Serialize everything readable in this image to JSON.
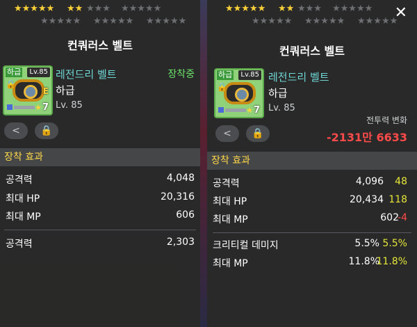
{
  "left": {
    "stars": {
      "row1a": "★★★★★",
      "row1b": "★★",
      "row1b_off": "★★★",
      "row1c": "★★★★★",
      "row2a": "★★★★★",
      "row2b": "★★★★★",
      "row2c": "★★★★★"
    },
    "title": "컨쿼러스 벨트",
    "item": {
      "grade_tag": "하급",
      "lv_tag": "Lv.85",
      "stack": "7",
      "e_badge": "E",
      "name": "레전드리 벨트",
      "grade": "하급",
      "level": "Lv. 85",
      "status": "장착중"
    },
    "section": "장착 효과",
    "stats": [
      {
        "name": "공격력",
        "value": "4,048"
      },
      {
        "name": "최대 HP",
        "value": "20,316"
      },
      {
        "name": "최대 MP",
        "value": "606"
      },
      {
        "name": "공격력",
        "value": "2,303"
      }
    ]
  },
  "right": {
    "stars": {
      "row1a": "★★★★★",
      "row1b": "★★",
      "row1b_off": "★★★",
      "row1c": "★★★★★",
      "row2a": "★★★★★",
      "row2b": "★★★★★",
      "row2c": "★★★★★"
    },
    "title": "컨쿼러스 벨트",
    "close": "✕",
    "item": {
      "grade_tag": "하급",
      "lv_tag": "Lv.85",
      "stack": "7",
      "name": "레전드리 벨트",
      "grade": "하급",
      "level": "Lv. 85"
    },
    "power_label": "전투력 변화",
    "power_value": "-2131만 6633",
    "section": "장착 효과",
    "stats": [
      {
        "name": "공격력",
        "value": "4,096",
        "diff": "48",
        "sign": "pos"
      },
      {
        "name": "최대 HP",
        "value": "20,434",
        "diff": "118",
        "sign": "pos"
      },
      {
        "name": "최대 MP",
        "value": "602",
        "diff": "-4",
        "sign": "neg"
      },
      {
        "name": "크리티컬 데미지",
        "value": "5.5%",
        "diff": "5.5%",
        "sign": "pos"
      },
      {
        "name": "최대 MP",
        "value": "11.8%",
        "diff": "11.8%",
        "sign": "pos"
      }
    ]
  },
  "colors": {
    "star_on": "#ffd23a",
    "star_off": "#6d6f73",
    "item_name": "#6fd6d6",
    "equip_status": "#6be36b",
    "section_header": "#ffd94a",
    "diff_positive": "#e6e639",
    "diff_negative": "#ff4a4a"
  },
  "icons": [
    "share-icon",
    "lock-icon",
    "close-icon",
    "star-icon",
    "belt-icon"
  ]
}
